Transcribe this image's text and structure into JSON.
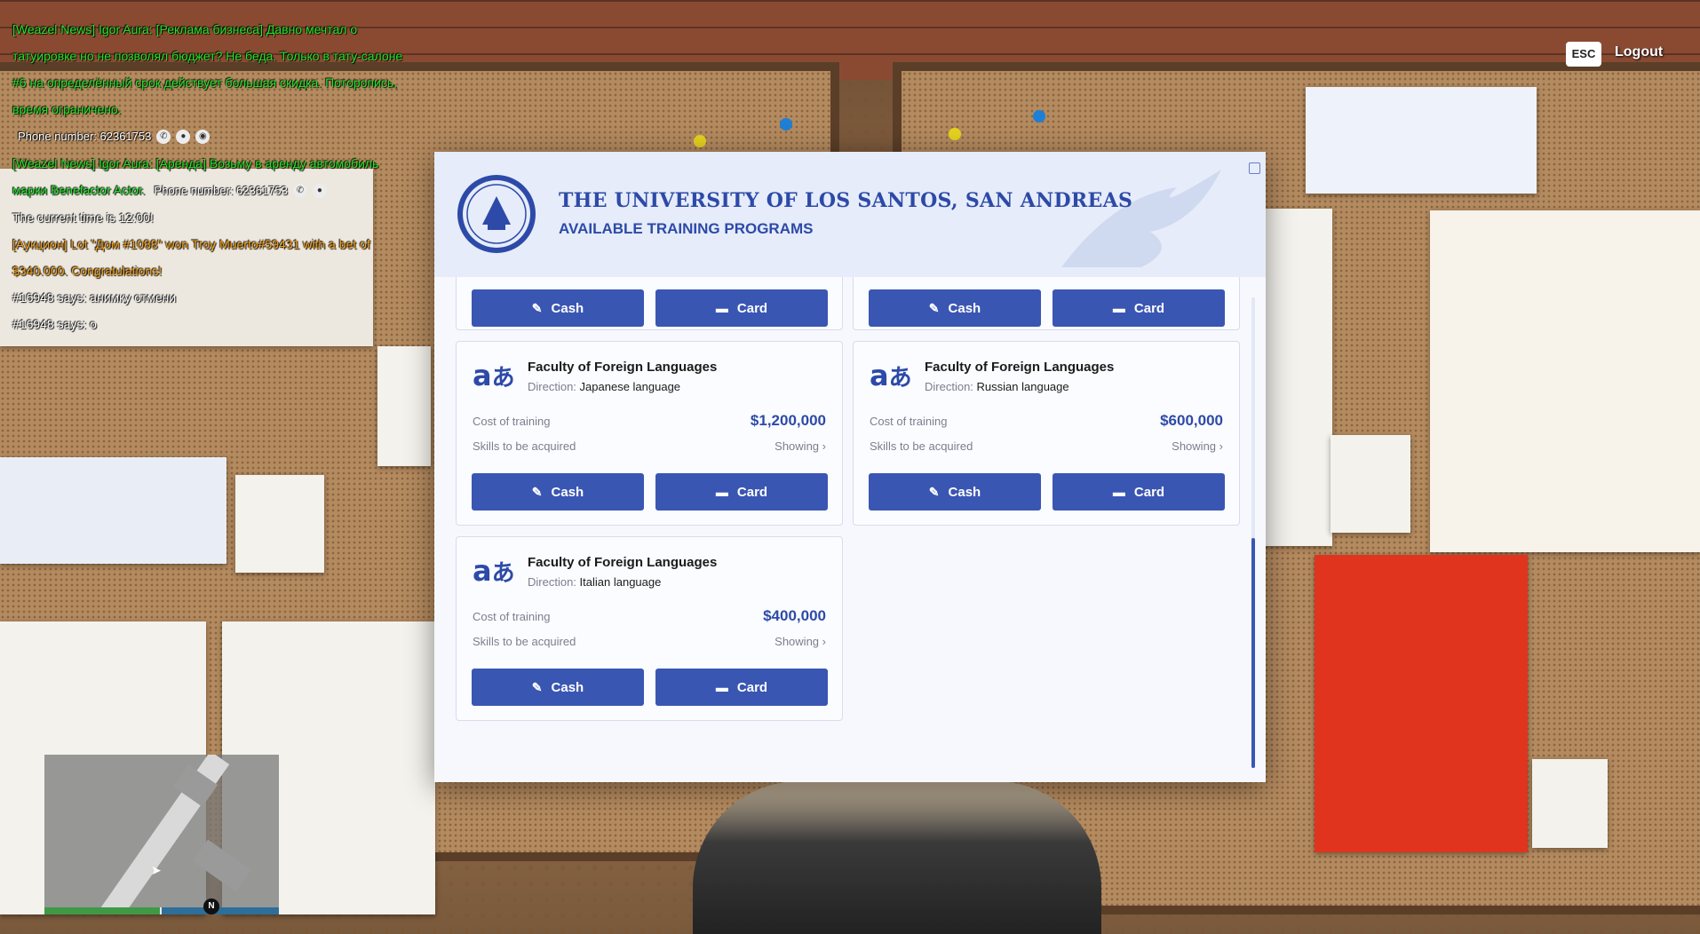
{
  "chat": {
    "l1": "[Weazel News] Igor Aura: [Реклама бизнеса] Давно мечтал о татуировке но не позволял бюджет? Не беда. Только в тату-салоне #6 на определённый срок действует большая скидка. Потoропись, время ограничено.",
    "phone1": "Phone number: 62361753",
    "l2": "[Weazel News] Igor Aura: [Аренда] Возьму в аренду автомобиль марки Benefactor Actor.",
    "phone2": "Phone number: 62361753",
    "l3": "The current time is 12:00!",
    "l4": "[Аукцион] Lot \"Дом #1088\" won Troy Muerto#59431 with a bet of $340.000. Congratulations!",
    "l5": "#16948 says: анимку отмени",
    "l6": "#16948 says: o"
  },
  "topbar": {
    "esc": "ESC",
    "logout": "Logout"
  },
  "modal": {
    "title": "THE UNIVERSITY OF LOS SANTOS, SAN ANDREAS",
    "subtitle": "AVAILABLE TRAINING PROGRAMS",
    "labels": {
      "cost": "Cost of training",
      "skills": "Skills to be acquired",
      "showing": "Showing",
      "direction": "Direction:",
      "cash": "Cash",
      "card": "Card"
    },
    "cards": [
      {
        "faculty": "Faculty of Foreign Languages",
        "direction": "Japanese language",
        "price": "$1,200,000"
      },
      {
        "faculty": "Faculty of Foreign Languages",
        "direction": "Russian language",
        "price": "$600,000"
      },
      {
        "faculty": "Faculty of Foreign Languages",
        "direction": "Italian language",
        "price": "$400,000"
      }
    ]
  },
  "minimap": {
    "compass": "N"
  },
  "colors": {
    "accent": "#3a56b3",
    "chat_green": "#23e52a",
    "chat_orange": "#f5a117"
  }
}
